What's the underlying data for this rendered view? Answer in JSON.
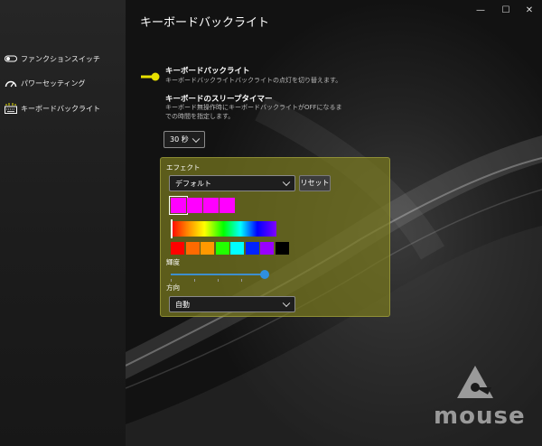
{
  "window": {
    "minimize_label": "—",
    "maximize_label": "☐",
    "close_label": "✕"
  },
  "sidebar": {
    "items": [
      {
        "label": "ファンクションスイッチ",
        "icon": "toggle-icon"
      },
      {
        "label": "パワーセッティング",
        "icon": "gauge-icon"
      },
      {
        "label": "キーボードバックライト",
        "icon": "keyboard-icon"
      }
    ]
  },
  "main": {
    "title": "キーボードバックライト",
    "backlight": {
      "title": "キーボードバックライト",
      "description": "キーボードバックライトバックライトの点灯を切り替えます。",
      "enabled": true
    },
    "sleep_timer": {
      "title": "キーボードのスリープタイマー",
      "description": "キーボード無操作時にキーボードバックライトがOFFになるまでの時間を指定します。",
      "value": "30 秒"
    },
    "effect": {
      "label": "エフェクト",
      "selected": "デフォルト",
      "reset_label": "リセット",
      "zone_colors": [
        "#ff00ff",
        "#ff00ff",
        "#ff00ff",
        "#ff00ff"
      ],
      "preset_colors": [
        "#ff0000",
        "#ff6a00",
        "#ff9900",
        "#22ff00",
        "#00ffff",
        "#0022ff",
        "#9900ff",
        "#000000"
      ],
      "brightness_label": "輝度",
      "brightness_level": 1.0,
      "direction_label": "方向",
      "direction_value": "自動"
    }
  },
  "brand": {
    "logo_text": "mouse"
  },
  "colors": {
    "accent": "#e8e000",
    "slider": "#2f8fe0",
    "panel": "#787820"
  }
}
